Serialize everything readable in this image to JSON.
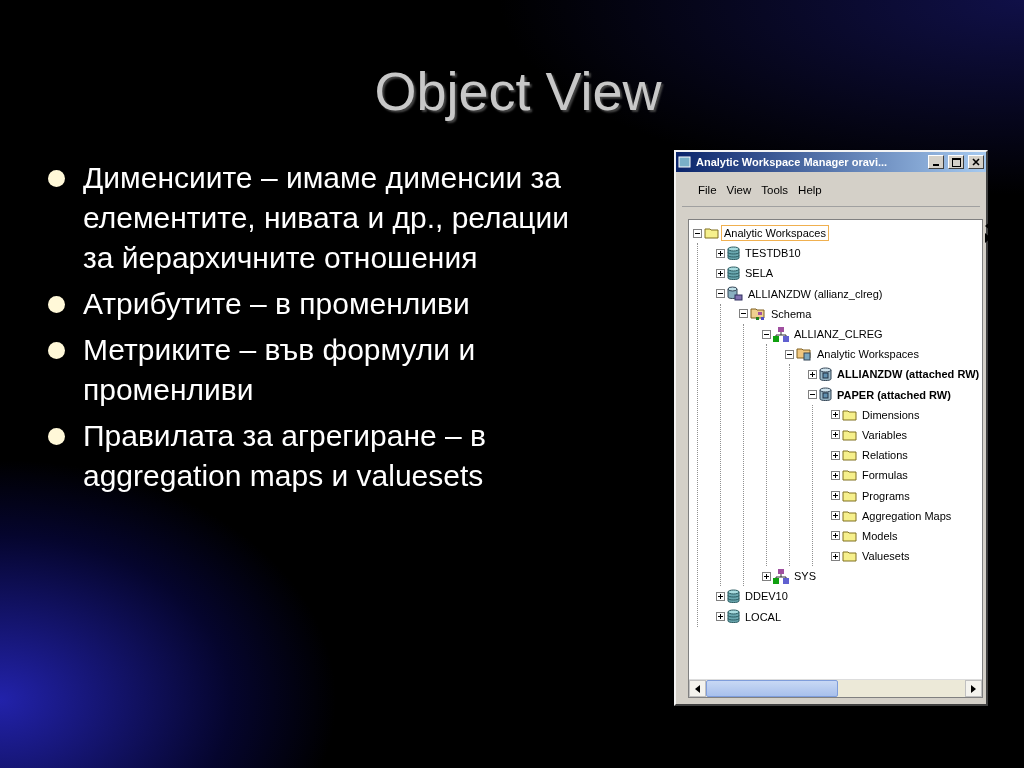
{
  "slide": {
    "title": "Object View",
    "bullets": [
      "Дименсиите – имаме дименсии за елементите, нивата и др., релации за йерархичните отношения",
      "Атрибутите – в променливи",
      "Метриките – във формули и променливи",
      "Правилата за агрегиране – в aggregation maps и valuesets"
    ]
  },
  "window": {
    "title": "Analytic Workspace Manager   oravi...",
    "menu": [
      "File",
      "View",
      "Tools",
      "Help"
    ],
    "tree": [
      {
        "label": "Analytic Workspaces",
        "kind": "folder",
        "expanded": true,
        "bold": false,
        "selected": true,
        "children": [
          {
            "label": "TESTDB10",
            "kind": "database",
            "expanded": false,
            "bold": false,
            "selected": false
          },
          {
            "label": "SELA",
            "kind": "database",
            "expanded": false,
            "bold": false,
            "selected": false
          },
          {
            "label": "ALLIANZDW (allianz_clreg)",
            "kind": "connection",
            "expanded": true,
            "bold": false,
            "selected": false,
            "children": [
              {
                "label": "Schema",
                "kind": "schema-folder",
                "expanded": true,
                "bold": false,
                "selected": false,
                "children": [
                  {
                    "label": "ALLIANZ_CLREG",
                    "kind": "schema",
                    "expanded": true,
                    "bold": false,
                    "selected": false,
                    "children": [
                      {
                        "label": "Analytic Workspaces",
                        "kind": "aw-folder",
                        "expanded": true,
                        "bold": false,
                        "selected": false,
                        "children": [
                          {
                            "label": "ALLIANZDW (attached RW)",
                            "kind": "aw",
                            "expanded": false,
                            "bold": true,
                            "selected": false
                          },
                          {
                            "label": "PAPER (attached RW)",
                            "kind": "aw",
                            "expanded": true,
                            "bold": true,
                            "selected": false,
                            "children": [
                              {
                                "label": "Dimensions",
                                "kind": "folder",
                                "expanded": false,
                                "bold": false,
                                "selected": false
                              },
                              {
                                "label": "Variables",
                                "kind": "folder",
                                "expanded": false,
                                "bold": false,
                                "selected": false
                              },
                              {
                                "label": "Relations",
                                "kind": "folder",
                                "expanded": false,
                                "bold": false,
                                "selected": false
                              },
                              {
                                "label": "Formulas",
                                "kind": "folder",
                                "expanded": false,
                                "bold": false,
                                "selected": false
                              },
                              {
                                "label": "Programs",
                                "kind": "folder",
                                "expanded": false,
                                "bold": false,
                                "selected": false
                              },
                              {
                                "label": "Aggregation Maps",
                                "kind": "folder",
                                "expanded": false,
                                "bold": false,
                                "selected": false
                              },
                              {
                                "label": "Models",
                                "kind": "folder",
                                "expanded": false,
                                "bold": false,
                                "selected": false
                              },
                              {
                                "label": "Valuesets",
                                "kind": "folder",
                                "expanded": false,
                                "bold": false,
                                "selected": false
                              }
                            ]
                          }
                        ]
                      }
                    ]
                  },
                  {
                    "label": "SYS",
                    "kind": "schema",
                    "expanded": false,
                    "bold": false,
                    "selected": false
                  }
                ]
              }
            ]
          },
          {
            "label": "DDEV10",
            "kind": "database",
            "expanded": false,
            "bold": false,
            "selected": false
          },
          {
            "label": "LOCAL",
            "kind": "database",
            "expanded": false,
            "bold": false,
            "selected": false
          }
        ]
      }
    ]
  }
}
